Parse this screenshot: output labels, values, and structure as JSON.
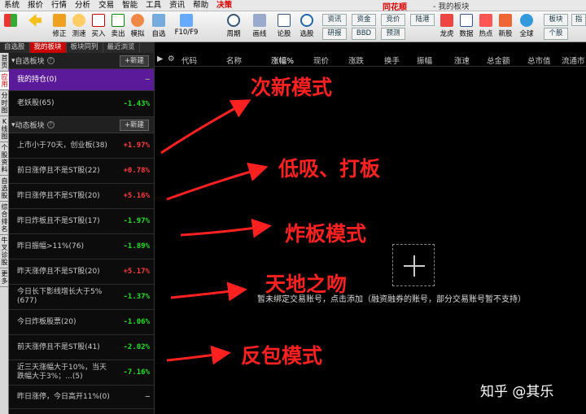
{
  "menubar": {
    "items": [
      "系统",
      "报价",
      "行情",
      "分析",
      "交易",
      "智能",
      "工具",
      "资讯",
      "帮助"
    ],
    "highlight": "决策",
    "brand": "同花顺",
    "window_title": "- 我的板块"
  },
  "toolbar": {
    "buttons": [
      "修正",
      "测速",
      "买入",
      "卖出",
      "模拟",
      "自选",
      "F10/F9",
      "周期",
      "画线",
      "论股",
      "选股"
    ],
    "small_buttons": [
      "资讯",
      "资金",
      "竞价",
      "陆港",
      "研报",
      "BBD",
      "预测"
    ],
    "right_buttons": [
      "龙虎",
      "数据",
      "热点",
      "新股",
      "全球"
    ],
    "far_right": [
      "板块",
      "个股",
      "指"
    ]
  },
  "tabs": [
    "自选股",
    "我的板块",
    "板块同列",
    "最近浏览"
  ],
  "vtabs": [
    "首页",
    "应用",
    "分时图",
    "K线图",
    "个股资料",
    "自选股",
    "综合排名",
    "牛叉诊股",
    "更多"
  ],
  "sections": {
    "watch": {
      "title": "自选板块",
      "new_label": "+新建"
    },
    "dynamic": {
      "title": "动态板块",
      "new_label": "+新建"
    }
  },
  "watch_rows": [
    {
      "name": "我的持仓(0)",
      "pct": "—",
      "dir": "nt"
    },
    {
      "name": "老妖股(65)",
      "pct": "-1.43%",
      "dir": "dn"
    }
  ],
  "dynamic_rows": [
    {
      "name": "上市小于70天，创业板(38)",
      "pct": "+1.97%",
      "dir": "up"
    },
    {
      "name": "前日涨停且不是ST股(22)",
      "pct": "+0.78%",
      "dir": "up"
    },
    {
      "name": "昨日涨停且不是ST股(20)",
      "pct": "+5.16%",
      "dir": "up"
    },
    {
      "name": "昨日炸板且不是ST股(17)",
      "pct": "-1.97%",
      "dir": "dn"
    },
    {
      "name": "昨日振幅>11%(76)",
      "pct": "-1.89%",
      "dir": "dn"
    },
    {
      "name": "昨天涨停且不是ST股(20)",
      "pct": "+5.17%",
      "dir": "up"
    },
    {
      "name": "今日长下影线增长大于5%(677)",
      "pct": "-1.37%",
      "dir": "dn"
    },
    {
      "name": "今日炸板股票(20)",
      "pct": "-1.06%",
      "dir": "dn"
    },
    {
      "name": "前天涨停且不是ST股(41)",
      "pct": "-2.02%",
      "dir": "dn"
    },
    {
      "name": "近三天涨幅大于10%，当天跌幅大于3%；...(5)",
      "pct": "-7.16%",
      "dir": "dn"
    },
    {
      "name": "昨日涨停，今日高开11%(0)",
      "pct": "—",
      "dir": "nt"
    }
  ],
  "columns": [
    "代码",
    "名称",
    "涨幅%",
    "现价",
    "涨跌",
    "换手",
    "振幅",
    "涨速",
    "总金额",
    "总市值",
    "流通市"
  ],
  "notice": "暂未绑定交易账号，点击添加（融资融券的账号，部分交易账号暂不支持）",
  "annotations": [
    "次新模式",
    "低吸、打板",
    "炸板模式",
    "天地之吻",
    "反包模式"
  ],
  "watermark": "知乎 @其乐",
  "colors": {
    "up": "#ff3b3b",
    "down": "#22e022",
    "selected": "#5a1a9a",
    "annotation": "#ff2020"
  }
}
